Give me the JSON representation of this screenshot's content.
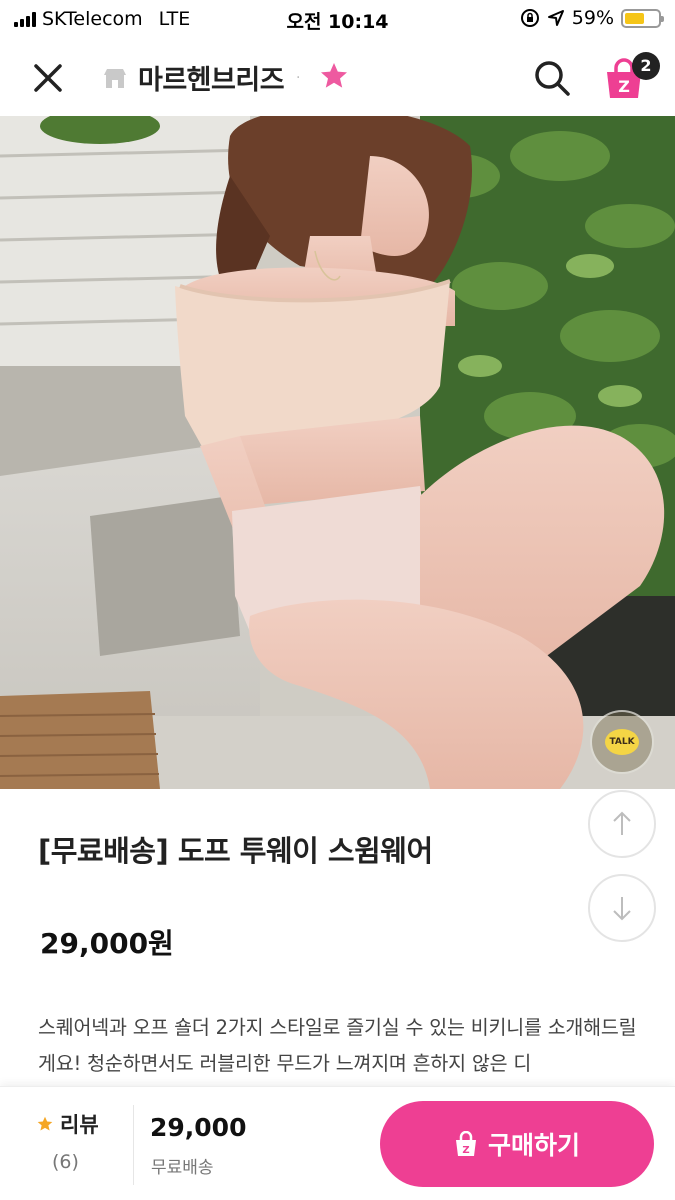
{
  "status_bar": {
    "carrier": "SKTelecom",
    "network": "LTE",
    "time": "오전 10:14",
    "battery_text": "59%",
    "battery_level": 0.59
  },
  "header": {
    "shop_name": "마르헨브리즈",
    "cart_count": "2"
  },
  "image": {
    "talk_label": "TALK"
  },
  "product": {
    "title": "[무료배송] 도프 투웨이 스윔웨어",
    "price": "29,000원",
    "description": "스퀘어넥과 오프 숄더 2가지 스타일로 즐기실 수 있는 비키니를 소개해드릴게요! 청순하면서도 러블리한 무드가 느껴지며 흔하지 않은 디"
  },
  "bottom_bar": {
    "review_label": "리뷰",
    "review_count": "(6)",
    "price": "29,000",
    "shipping": "무료배송",
    "buy_label": "구매하기"
  },
  "colors": {
    "accent_pink": "#ee3f93",
    "star_pink": "#ee5aa0",
    "review_star": "#f5a623"
  }
}
